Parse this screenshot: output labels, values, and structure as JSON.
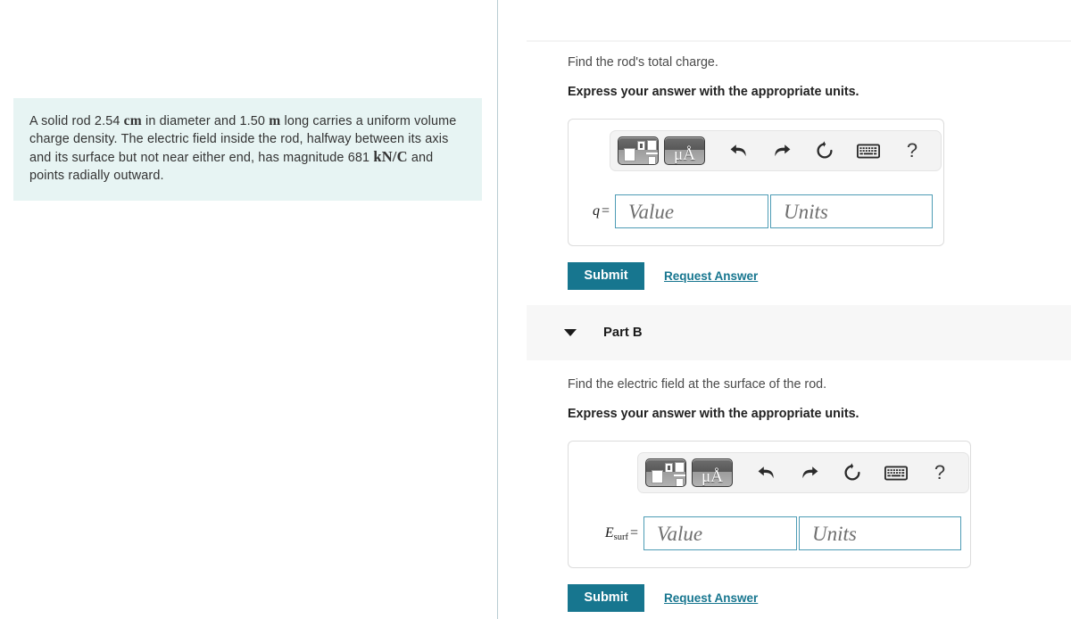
{
  "problem": {
    "segments": [
      {
        "t": "A solid rod 2.54 ",
        "m": false
      },
      {
        "t": "cm",
        "m": true
      },
      {
        "t": " in diameter and 1.50 ",
        "m": false
      },
      {
        "t": "m",
        "m": true
      },
      {
        "t": " long carries a uniform volume charge density. The electric field inside the rod, halfway between its axis and its surface but not near either end, has magnitude 681 ",
        "m": false
      },
      {
        "t": "kN/C",
        "m": true
      },
      {
        "t": " and points radially outward.",
        "m": false
      }
    ],
    "text": "A solid rod 2.54 cm in diameter and 1.50 m long carries a uniform volume charge density. The electric field inside the rod, halfway between its axis and its surface but not near either end, has magnitude 681 kN/C and points radially outward.",
    "line1": "A solid rod 2.54 cm in diameter and 1.50 m long carries a uniform",
    "line2": "volume charge density. The electric field inside the rod, halfway",
    "line3": "between its axis and its surface but not near either end, has magnitude",
    "line4": "681 kN/C and points radially outward.",
    "background_color": "#e7f4f3"
  },
  "accent_color": "#17768f",
  "field_border_color": "#4d9cb5",
  "toolbar": {
    "template_button_label": "math-template",
    "units_button_label": "μÅ",
    "undo_label": "undo",
    "redo_label": "redo",
    "reset_label": "reset",
    "keyboard_label": "keyboard",
    "help_label": "?"
  },
  "parts": [
    {
      "id": "part-a",
      "header_visible": false,
      "header_title": "",
      "prompt": "Find the rod's total charge.",
      "instruction": "Express your answer with the appropriate units.",
      "variable_symbol": "q",
      "variable_subscript": "",
      "equals": "=",
      "value_placeholder": "Value",
      "units_placeholder": "Units",
      "value_current": "",
      "units_current": "",
      "submit_label": "Submit",
      "request_answer_label": "Request Answer"
    },
    {
      "id": "part-b",
      "header_visible": true,
      "header_title": "Part B",
      "prompt": "Find the electric field at the surface of the rod.",
      "instruction": "Express your answer with the appropriate units.",
      "variable_symbol": "E",
      "variable_subscript": "surf",
      "equals": "=",
      "value_placeholder": "Value",
      "units_placeholder": "Units",
      "value_current": "",
      "units_current": "",
      "submit_label": "Submit",
      "request_answer_label": "Request Answer"
    }
  ]
}
